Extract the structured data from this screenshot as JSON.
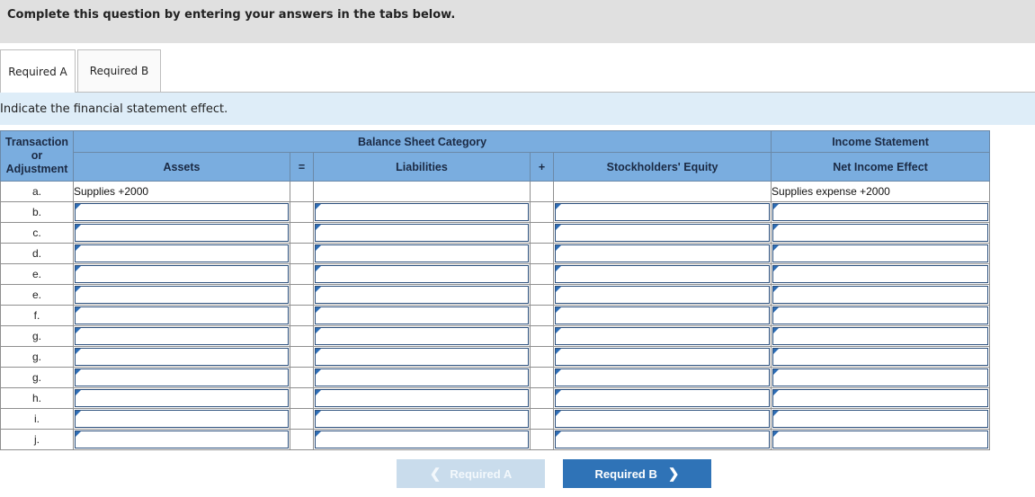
{
  "instruction": "Complete this question by entering your answers in the tabs below.",
  "tabs": [
    {
      "label": "Required A",
      "active": true
    },
    {
      "label": "Required B",
      "active": false
    }
  ],
  "prompt": "Indicate the financial statement effect.",
  "table": {
    "header": {
      "transaction_line1": "Transaction",
      "transaction_line2": "or",
      "transaction_line3": "Adjustment",
      "balance_sheet_category": "Balance Sheet Category",
      "income_statement": "Income Statement",
      "assets": "Assets",
      "equals": "=",
      "liabilities": "Liabilities",
      "plus": "+",
      "stockholders_equity": "Stockholders' Equity",
      "net_income_effect": "Net Income Effect"
    },
    "rows": [
      {
        "label": "a.",
        "assets": "Supplies +2000",
        "liabilities": "",
        "equity": "",
        "net_income": "Supplies expense +2000",
        "editable": false
      },
      {
        "label": "b.",
        "editable": true
      },
      {
        "label": "c.",
        "editable": true
      },
      {
        "label": "d.",
        "editable": true
      },
      {
        "label": "e.",
        "editable": true
      },
      {
        "label": "e.",
        "editable": true
      },
      {
        "label": "f.",
        "editable": true
      },
      {
        "label": "g.",
        "editable": true
      },
      {
        "label": "g.",
        "editable": true
      },
      {
        "label": "g.",
        "editable": true
      },
      {
        "label": "h.",
        "editable": true
      },
      {
        "label": "i.",
        "editable": true
      },
      {
        "label": "j.",
        "editable": true
      }
    ]
  },
  "nav": {
    "prev_label": "Required A",
    "prev_icon": "chevron-left-icon",
    "prev_enabled": false,
    "next_label": "Required B",
    "next_icon": "chevron-right-icon",
    "next_enabled": true
  },
  "colors": {
    "header_bg": "#7aaddf",
    "prompt_bg": "#deedf8",
    "next_button": "#2f73b7",
    "prev_button_disabled": "#c9dcec"
  }
}
